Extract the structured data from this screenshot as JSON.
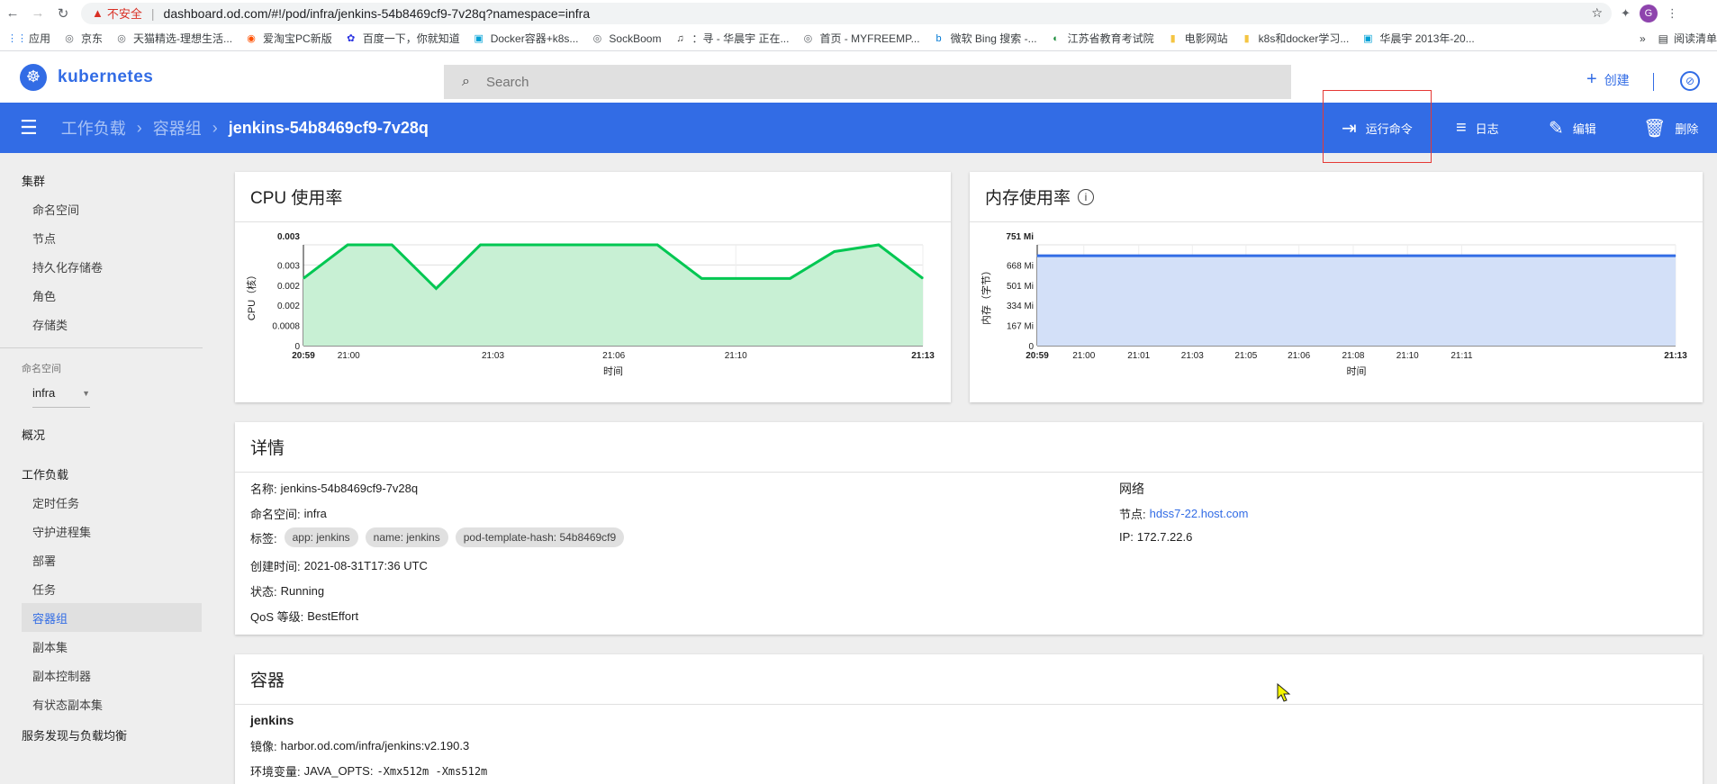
{
  "browser": {
    "insecure_label": "不安全",
    "url": "dashboard.od.com/#!/pod/infra/jenkins-54b8469cf9-7v28q?namespace=infra",
    "avatar_letter": "G",
    "bookmarks": [
      {
        "icon": "apps-icon",
        "label": "应用"
      },
      {
        "icon": "globe-icon",
        "label": "京东"
      },
      {
        "icon": "globe-icon",
        "label": "天猫精选-理想生活..."
      },
      {
        "icon": "taobao-icon",
        "label": "爱淘宝PC新版"
      },
      {
        "icon": "baidu-icon",
        "label": "百度一下，你就知道"
      },
      {
        "icon": "tv-icon",
        "label": "Docker容器+k8s..."
      },
      {
        "icon": "globe-icon",
        "label": "SockBoom"
      },
      {
        "icon": "music-icon",
        "label": "：寻 - 华晨宇 正在..."
      },
      {
        "icon": "globe-icon",
        "label": "首页 - MYFREEMP..."
      },
      {
        "icon": "bing-icon",
        "label": "微软 Bing 搜索 -..."
      },
      {
        "icon": "shield-icon",
        "label": "江苏省教育考试院"
      },
      {
        "icon": "folder-icon",
        "label": "电影网站"
      },
      {
        "icon": "folder-icon",
        "label": "k8s和docker学习..."
      },
      {
        "icon": "tv-icon",
        "label": "华晨宇 2013年-20..."
      }
    ],
    "reading_list": "阅读清单"
  },
  "header": {
    "logo_text": "kubernetes",
    "search_placeholder": "Search",
    "create_label": "创建"
  },
  "actionbar": {
    "crumb_1": "工作负载",
    "crumb_2": "容器组",
    "crumb_current": "jenkins-54b8469cf9-7v28q",
    "exec_label": "运行命令",
    "logs_label": "日志",
    "edit_label": "编辑",
    "delete_label": "删除"
  },
  "sidebar": {
    "cluster_head": "集群",
    "cluster_items": [
      "命名空间",
      "节点",
      "持久化存储卷",
      "角色",
      "存储类"
    ],
    "ns_label": "命名空间",
    "ns_value": "infra",
    "overview": "概况",
    "workloads_head": "工作负载",
    "workload_items": [
      "定时任务",
      "守护进程集",
      "部署",
      "任务",
      "容器组",
      "副本集",
      "副本控制器",
      "有状态副本集"
    ],
    "active_item": "容器组",
    "service_head": "服务发现与负载均衡"
  },
  "cpu_card": {
    "title": "CPU 使用率"
  },
  "mem_card": {
    "title": "内存使用率"
  },
  "chart_data": [
    {
      "type": "area",
      "title": "CPU 使用率",
      "xlabel": "时间",
      "ylabel": "CPU（核）",
      "x_ticks": [
        "20:59",
        "21:00",
        "21:03",
        "21:06",
        "21:10",
        "21:13"
      ],
      "y_ticks": [
        "0",
        "0.0008",
        "0.002",
        "0.002",
        "0.003",
        "0.003"
      ],
      "x": [
        "20:59",
        "21:00",
        "21:01",
        "21:02",
        "21:03",
        "21:04",
        "21:05",
        "21:06",
        "21:07",
        "21:08",
        "21:09",
        "21:10",
        "21:11",
        "21:12",
        "21:13"
      ],
      "values": [
        0.002,
        0.003,
        0.003,
        0.0017,
        0.003,
        0.003,
        0.003,
        0.003,
        0.003,
        0.002,
        0.002,
        0.002,
        0.0028,
        0.003,
        0.002
      ],
      "ylim": [
        0,
        0.003
      ],
      "color": "#00c752"
    },
    {
      "type": "area",
      "title": "内存使用率",
      "xlabel": "时间",
      "ylabel": "内存（字节）",
      "x_ticks": [
        "20:59",
        "21:00",
        "21:01",
        "21:03",
        "21:05",
        "21:06",
        "21:08",
        "21:10",
        "21:11",
        "21:13"
      ],
      "y_ticks": [
        "0",
        "167 Mi",
        "334 Mi",
        "501 Mi",
        "668 Mi",
        "751 Mi"
      ],
      "x": [
        "20:59",
        "21:13"
      ],
      "values": [
        670,
        670
      ],
      "ylim": [
        0,
        751
      ],
      "color": "#326ce5"
    }
  ],
  "details": {
    "title": "详情",
    "name_label": "名称:",
    "name_value": "jenkins-54b8469cf9-7v28q",
    "ns_label": "命名空间:",
    "ns_value": "infra",
    "labels_label": "标签:",
    "labels": [
      "app: jenkins",
      "name: jenkins",
      "pod-template-hash: 54b8469cf9"
    ],
    "created_label": "创建时间:",
    "created_value": "2021-08-31T17:36 UTC",
    "status_label": "状态:",
    "status_value": "Running",
    "qos_label": "QoS 等级:",
    "qos_value": "BestEffort",
    "network_head": "网络",
    "node_label": "节点:",
    "node_value": "hdss7-22.host.com",
    "ip_label": "IP:",
    "ip_value": "172.7.22.6"
  },
  "containers": {
    "title": "容器",
    "name": "jenkins",
    "image_label": "镜像:",
    "image_value": "harbor.od.com/infra/jenkins:v2.190.3",
    "env_label": "环境变量:",
    "env_name": "JAVA_OPTS:",
    "env_value": "-Xmx512m -Xms512m"
  }
}
